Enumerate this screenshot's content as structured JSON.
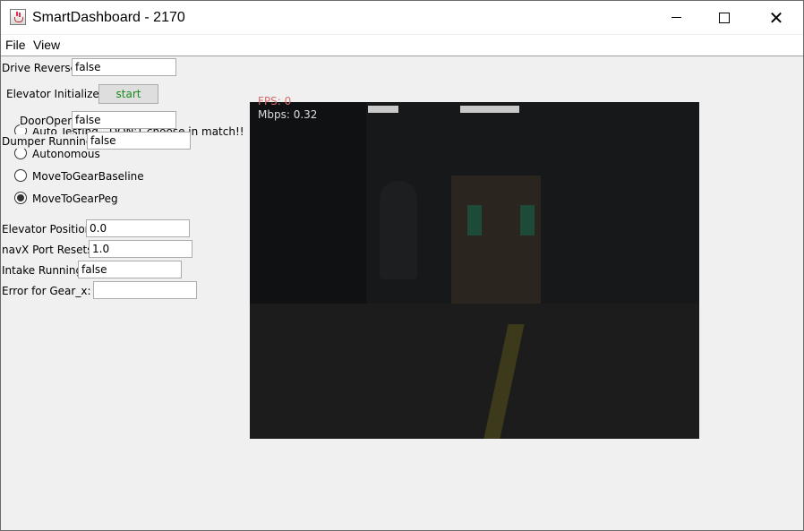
{
  "window": {
    "title": "SmartDashboard - 2170",
    "minimize_glyph": "",
    "close_glyph": "✕"
  },
  "menu": {
    "file": "File",
    "view": "View"
  },
  "widgets": {
    "drive_reverse": {
      "label": "Drive Reverse",
      "value": "false"
    },
    "elevator_initialize": {
      "label": "Elevator Initialize",
      "button": "start"
    },
    "door_open": {
      "label": "DoorOpen",
      "value": "false"
    },
    "dumper_running": {
      "label": "Dumper Running",
      "value": "false"
    },
    "elevator_position": {
      "label": "Elevator Position",
      "value": "0.0"
    },
    "navx_port_resets": {
      "label": "navX Port Resets",
      "value": "1.0"
    },
    "intake_running": {
      "label": "Intake Running",
      "value": "false"
    },
    "error_gear_x": {
      "label": "Error for Gear_x:",
      "value": ""
    }
  },
  "auto_chooser": {
    "options": [
      {
        "label": "Auto Testing - DON'T choose in match!!",
        "selected": false
      },
      {
        "label": "Autonomous",
        "selected": false
      },
      {
        "label": "MoveToGearBaseline",
        "selected": false
      },
      {
        "label": "MoveToGearPeg",
        "selected": true
      }
    ]
  },
  "camera": {
    "fps": "FPS: 0",
    "mbps": "Mbps: 0.32",
    "fps_color": "#d86c6c",
    "mbps_color": "#dcdcdc"
  },
  "colors": {
    "button_text": "#1a8a1a",
    "window_bg": "#f0f0f0"
  }
}
